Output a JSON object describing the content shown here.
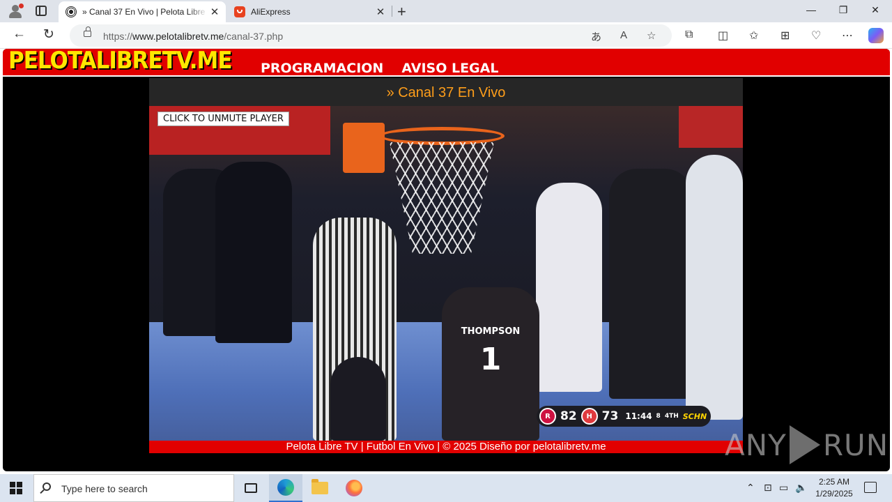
{
  "browser": {
    "tabs": [
      {
        "title": "» Canal 37 En Vivo | Pelota Libre TV",
        "active": true
      },
      {
        "title": "AliExpress",
        "active": false
      }
    ],
    "new_tab_label": "+",
    "url_prefix": "https://",
    "url_host": "www.pelotalibretv.me",
    "url_path": "/canal-37.php"
  },
  "site": {
    "logo": "PELOTALIBRETV.ME",
    "nav": [
      "PROGRAMACION",
      "AVISO LEGAL"
    ],
    "channel_title": "» Canal 37 En Vivo",
    "unmute_label": "CLICK TO UNMUTE PLAYER",
    "footer": "Pelota Libre TV | Futbol En Vivo | © 2025 Diseño por pelotalibretv.me",
    "colors": {
      "header": "#e10000",
      "logo": "#ffe600",
      "title": "#ff9e1a"
    }
  },
  "video": {
    "jersey_name": "THOMPSON",
    "jersey_number": "1",
    "scorebug": {
      "home_score": "82",
      "away_score": "73",
      "clock": "11:44",
      "shot_clock": "8",
      "period": "4TH",
      "network": "SCHN"
    }
  },
  "watermark": {
    "left": "ANY",
    "right": "RUN"
  },
  "taskbar": {
    "search_placeholder": "Type here to search",
    "time": "2:25 AM",
    "date": "1/29/2025"
  }
}
